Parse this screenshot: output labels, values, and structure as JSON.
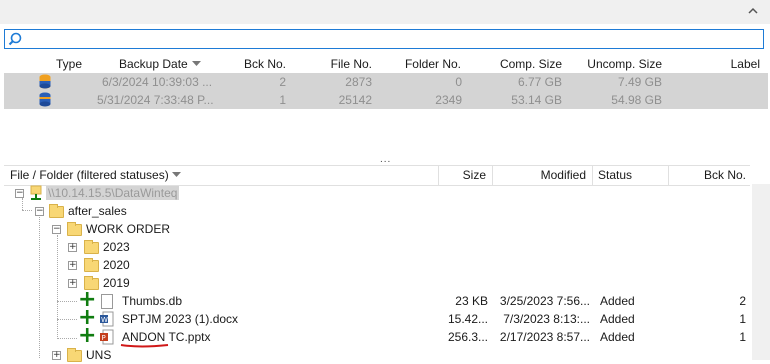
{
  "search": {
    "placeholder": "",
    "value": ""
  },
  "backup_table": {
    "columns": [
      "Type",
      "Backup Date",
      "Bck No.",
      "File No.",
      "Folder No.",
      "Comp. Size",
      "Uncomp. Size",
      "Label"
    ],
    "rows": [
      {
        "date": "6/3/2024 10:39:03 ...",
        "bck": "2",
        "files": "2873",
        "folders": "0",
        "comp": "6.77 GB",
        "uncomp": "7.49 GB",
        "label": ""
      },
      {
        "date": "5/31/2024 7:33:48 P...",
        "bck": "1",
        "files": "25142",
        "folders": "2349",
        "comp": "53.14 GB",
        "uncomp": "54.98 GB",
        "label": ""
      }
    ]
  },
  "splitter": "...",
  "file_table": {
    "columns": [
      "File / Folder (filtered statuses)",
      "Size",
      "Modified",
      "Status",
      "Bck No."
    ],
    "root": "\\\\10.14.15.5\\DataWinteq",
    "tree": [
      {
        "name": "after_sales"
      },
      {
        "name": "WORK ORDER"
      },
      {
        "name": "2023"
      },
      {
        "name": "2020"
      },
      {
        "name": "2019"
      },
      {
        "name": "Thumbs.db",
        "size": "23 KB",
        "modified": "3/25/2023 7:56...",
        "status": "Added",
        "bck": "2"
      },
      {
        "name": "SPTJM 2023 (1).docx",
        "size": "15.42...",
        "modified": "7/3/2023 8:13:...",
        "status": "Added",
        "bck": "1"
      },
      {
        "name": "ANDON TC.pptx",
        "size": "256.3...",
        "modified": "2/17/2023 8:57...",
        "status": "Added",
        "bck": "1"
      },
      {
        "name": "UNS"
      }
    ]
  },
  "colors": {
    "accent": "#1e7bd6",
    "added_green": "#107c10",
    "selected_row": "#d4d4d4",
    "annotation_red": "#d01818"
  }
}
